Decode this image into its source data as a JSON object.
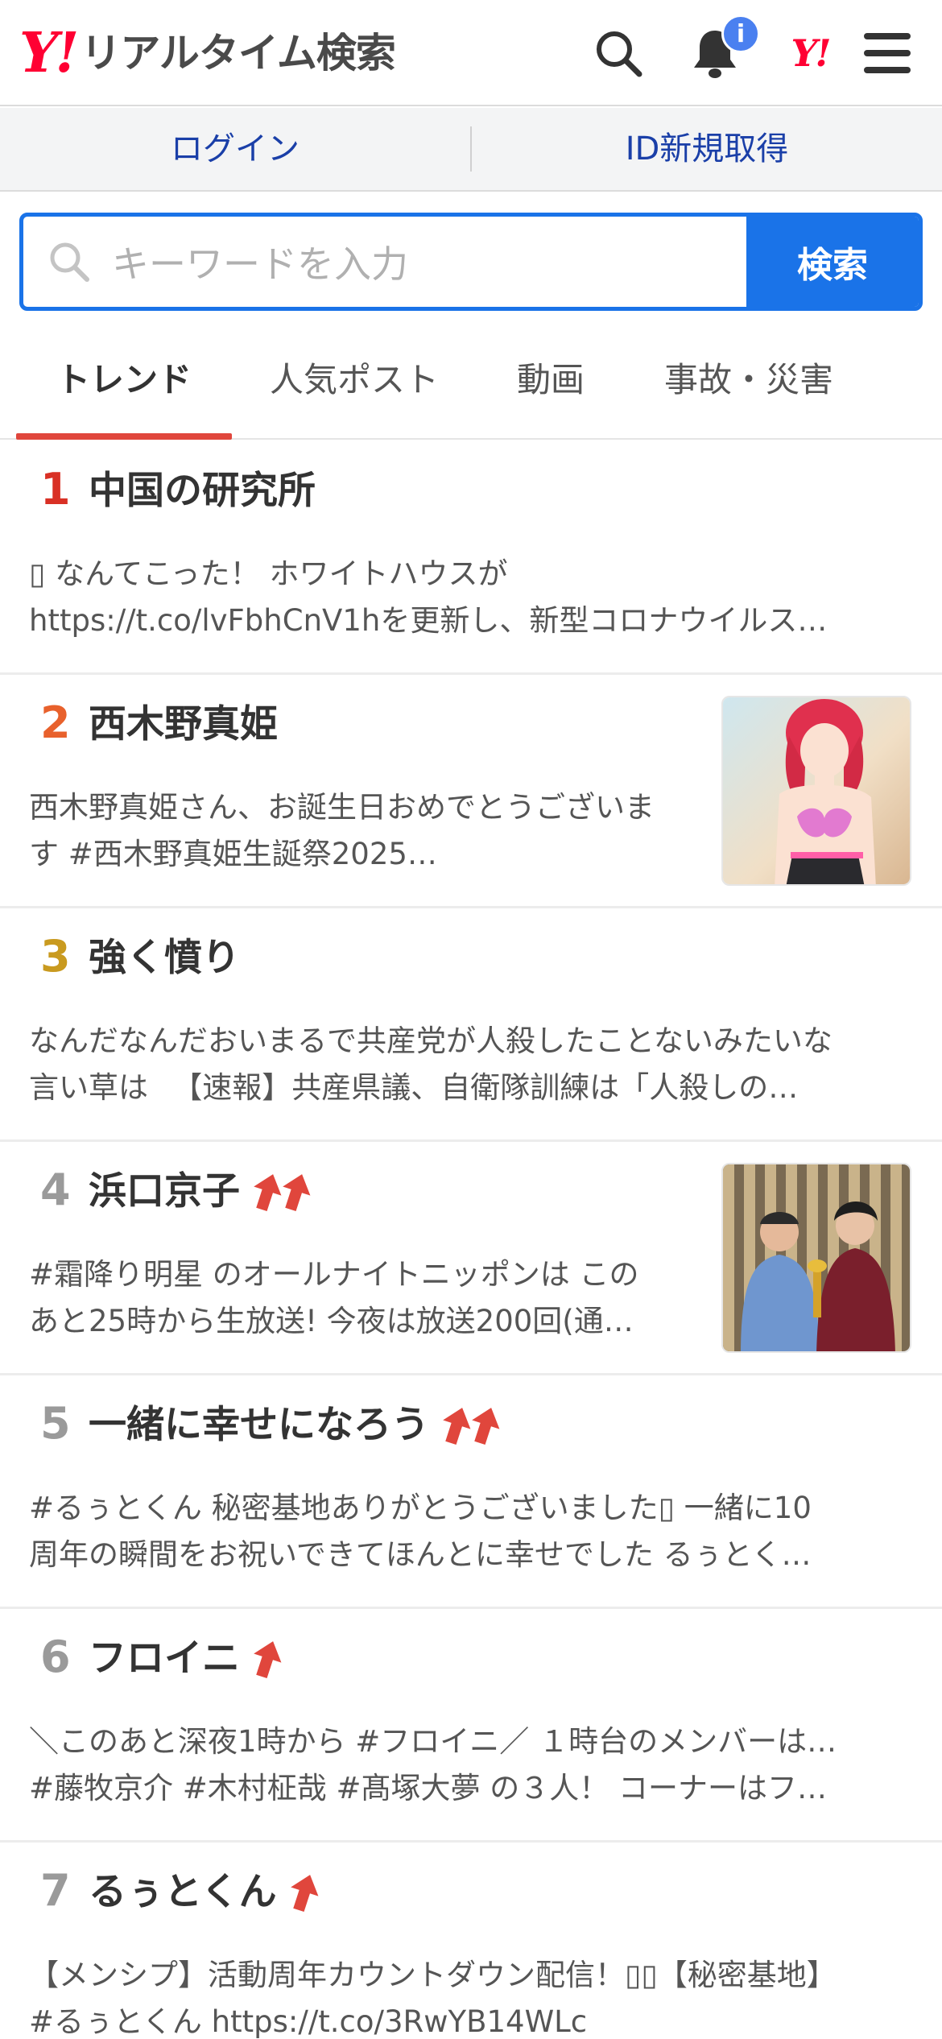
{
  "header": {
    "logo_mark": "Y!",
    "logo_text": "リアルタイム検索",
    "notification_badge": "i",
    "yahoo_mark": "Y!"
  },
  "login_bar": {
    "login": "ログイン",
    "register": "ID新規取得"
  },
  "search": {
    "placeholder": "キーワードを入力",
    "button": "検索"
  },
  "tabs": [
    "トレンド",
    "人気ポスト",
    "動画",
    "事故・災害"
  ],
  "trends": [
    {
      "rank": "1",
      "title": "中国の研究所",
      "line1": "▯ なんてこった！ ホワイトハウスが",
      "line2": "https://t.co/lvFbhCnV1hを更新し、新型コロナウイルス…",
      "arrows": 0
    },
    {
      "rank": "2",
      "title": "西木野真姫",
      "line1": "西木野真姫さん、お誕生日おめでとうございま",
      "line2": "す #西木野真姫生誕祭2025…",
      "arrows": 0,
      "thumb": "anime-character-thumbnail"
    },
    {
      "rank": "3",
      "title": "強く憤り",
      "line1": "なんだなんだおいまるで共産党が人殺したことないみたいな",
      "line2": "言い草は 　【速報】共産県議、自衛隊訓練は「人殺しの…",
      "arrows": 0
    },
    {
      "rank": "4",
      "title": "浜口京子",
      "line1": "#霜降り明星 のオールナイトニッポンは この",
      "line2": "あと25時から生放送! 今夜は放送200回(通…",
      "arrows": 2,
      "thumb": "radio-studio-photo-thumbnail"
    },
    {
      "rank": "5",
      "title": "一緒に幸せになろう",
      "line1": "#るぅとくん 秘密基地ありがとうございました▯ 一緒に10",
      "line2": "周年の瞬間をお祝いできてほんとに幸せでした るぅとく…",
      "arrows": 2
    },
    {
      "rank": "6",
      "title": "フロイニ",
      "line1": "＼このあと深夜1時から #フロイニ／ １時台のメンバーは…",
      "line2": "#藤牧京介 #木村柾哉 #髙塚大夢 の３人！ コーナーはフ…",
      "arrows": 1
    },
    {
      "rank": "7",
      "title": "るぅとくん",
      "line1": "【メンシプ】活動周年カウントダウン配信！▯▯【秘密基地】",
      "line2": "#るぅとくん https://t.co/3RwYB14WLc",
      "arrows": 1
    }
  ],
  "colors": {
    "accent_blue": "#1a73e8",
    "tab_underline": "#e0463c",
    "rank1": "#d93025",
    "rank2": "#e8612c",
    "rank3": "#c99a1f",
    "rank_other": "#9a9a9a",
    "arrow": "#e0463c"
  }
}
